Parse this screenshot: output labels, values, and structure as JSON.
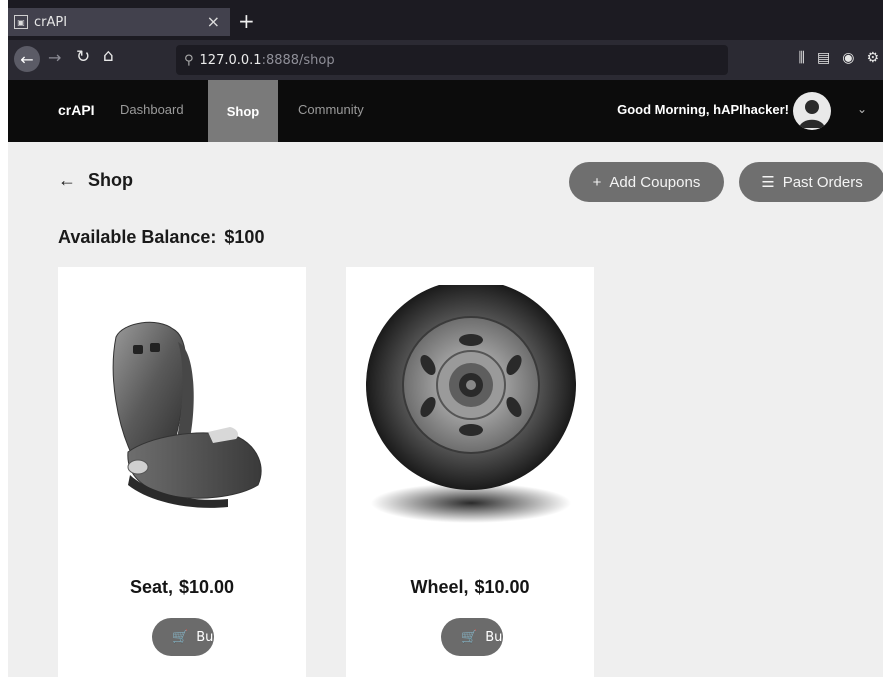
{
  "browser": {
    "tab_title": "crAPI",
    "url_host": "127.0.0.1",
    "url_path": ":8888/shop"
  },
  "nav": {
    "brand": "crAPI",
    "links": [
      "Dashboard",
      "Shop",
      "Community"
    ],
    "greeting": "Good Morning, hAPIhacker!"
  },
  "page": {
    "title": "Shop",
    "add_coupons": "Add Coupons",
    "past_orders": "Past Orders",
    "balance_label": "Available Balance:",
    "balance_value": "$100"
  },
  "products": [
    {
      "name": "Seat,",
      "price": "$10.00",
      "buy_label": "Buy"
    },
    {
      "name": "Wheel,",
      "price": "$10.00",
      "buy_label": "Buy"
    }
  ],
  "icons": {
    "back": "arrow-left-icon",
    "reload": "reload-icon",
    "home": "home-icon",
    "cart": "cart-icon",
    "plus": "plus-icon",
    "list": "list-icon"
  }
}
